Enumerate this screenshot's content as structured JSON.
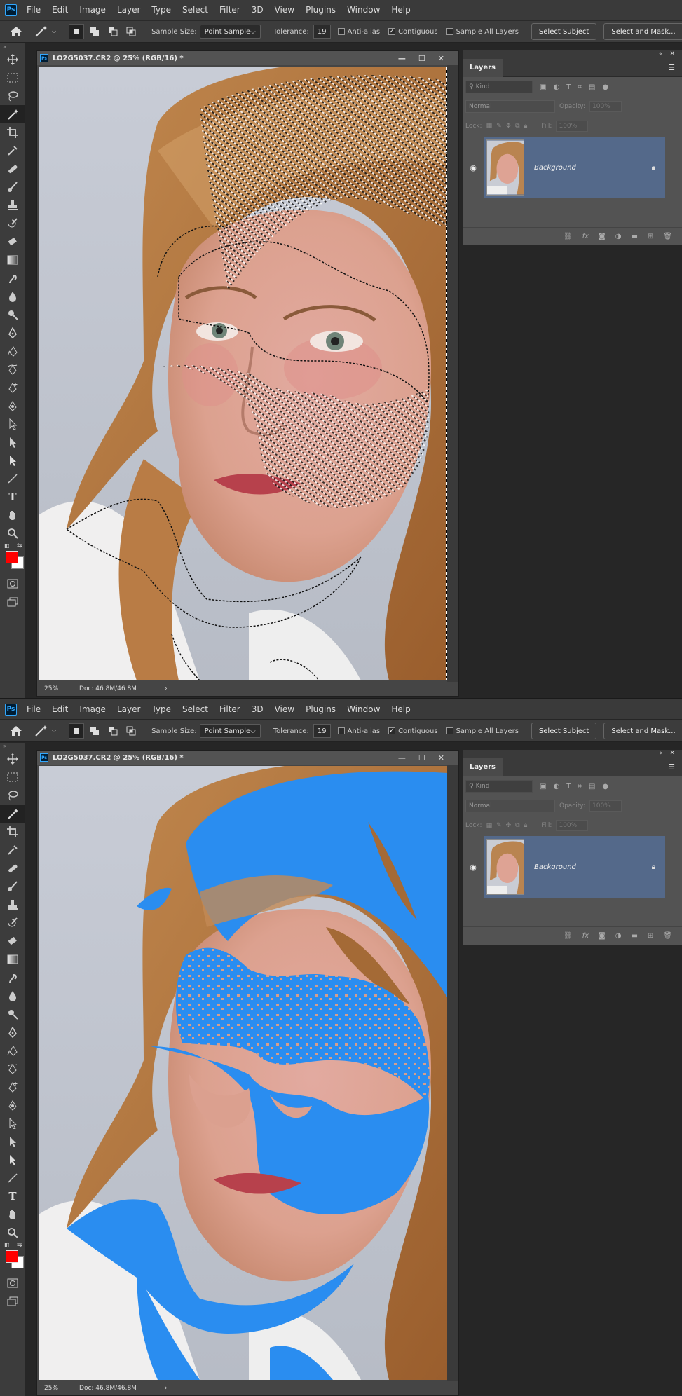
{
  "menu": [
    "File",
    "Edit",
    "Image",
    "Layer",
    "Type",
    "Select",
    "Filter",
    "3D",
    "View",
    "Plugins",
    "Window",
    "Help"
  ],
  "options": {
    "sample_size_label": "Sample Size:",
    "sample_size_value": "Point Sample",
    "tolerance_label": "Tolerance:",
    "tolerance_value": "19",
    "anti_alias": "Anti-alias",
    "contiguous": "Contiguous",
    "sample_all_layers": "Sample All Layers",
    "select_subject": "Select Subject",
    "select_and_mask": "Select and Mask..."
  },
  "document": {
    "title": "LO2G5037.CR2 @ 25% (RGB/16) *",
    "zoom": "25%",
    "doc_info": "Doc: 46.8M/46.8M"
  },
  "layers_panel": {
    "tab": "Layers",
    "kind": "Kind",
    "blend_mode": "Normal",
    "opacity_label": "Opacity:",
    "opacity_value": "100%",
    "lock_label": "Lock:",
    "fill_label": "Fill:",
    "fill_value": "100%",
    "layer_name": "Background"
  },
  "colors": {
    "foreground": "#ff0000",
    "background": "#ffffff",
    "selection_overlay": "#2a8df0"
  },
  "screens": [
    {
      "state": "marching-ants selection"
    },
    {
      "state": "blue selection overlay"
    }
  ]
}
